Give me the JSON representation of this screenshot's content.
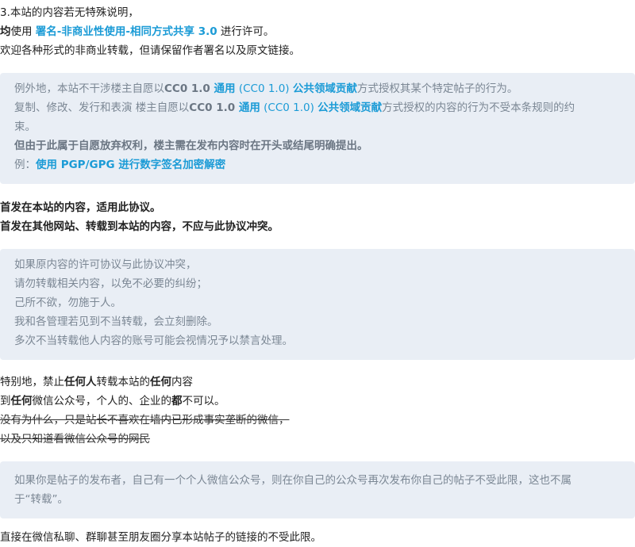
{
  "intro": {
    "line1": "3.本站的内容若无特殊说明，",
    "line2_prefix": "均",
    "line2_mid": "使用 ",
    "license_link": "署名-非商业性使用-相同方式共享 3.0",
    "line2_suffix": " 进行许可。",
    "line3": "欢迎各种形式的非商业转载，但请保留作者署名以及原文链接。"
  },
  "quote1": {
    "l1_a": "例外地，本站不干涉楼主自愿以",
    "l1_cc0": "CC0 1.0 ",
    "l1_link1": "通用",
    "l1_paren": " (CC0 1.0) ",
    "l1_link2": "公共领域贡献",
    "l1_b": "方式授权其某个特定帖子的行为。",
    "l2_a": "复制、修改、发行和表演 楼主自愿以",
    "l2_cc0": "CC0 1.0 ",
    "l2_link1": "通用",
    "l2_paren": " (CC0 1.0) ",
    "l2_link2": "公共领域贡献",
    "l2_b": "方式授权的内容的行为不受本条规则的约",
    "l3": "束。",
    "l4": "但由于此属于自愿放弃权利，楼主需在发布内容时在开头或结尾明确提出。",
    "l5_prefix": "例：",
    "l5_link": "使用 PGP/GPG 进行数字签名加密解密"
  },
  "bold_block": {
    "line1": "首发在本站的内容，适用此协议。",
    "line2": "首发在其他网站、转载到本站的内容，不应与此协议冲突。"
  },
  "quote2": {
    "lines": [
      "如果原内容的许可协议与此协议冲突，",
      "请勿转载相关内容，以免不必要的纠纷；",
      "己所不欲，勿施于人。",
      "我和各管理若见到不当转载，会立刻删除。",
      "多次不当转载他人内容的账号可能会视情况予以禁言处理。"
    ]
  },
  "special": {
    "l1_a": "特别地，禁止",
    "l1_b": "任何人",
    "l1_c": "转载本站的",
    "l1_d": "任何",
    "l1_e": "内容",
    "l2_a": "到",
    "l2_b": "任何",
    "l2_c": "微信公众号，个人的、企业的",
    "l2_d": "都",
    "l2_e": "不可以。",
    "strike1": "没有为什么，只是站长不喜欢在墙内已形成事实垄断的微信，",
    "strike2": "以及只知道看微信公众号的网民"
  },
  "quote3": {
    "l1": "如果你是帖子的发布者，自己有一个个人微信公众号，则在你自己的公众号再次发布你自己的帖子不受此限，这也不属",
    "l2": "于“转载”。"
  },
  "footer": {
    "line": "直接在微信私聊、群聊甚至朋友圈分享本站帖子的链接的不受此限。"
  }
}
